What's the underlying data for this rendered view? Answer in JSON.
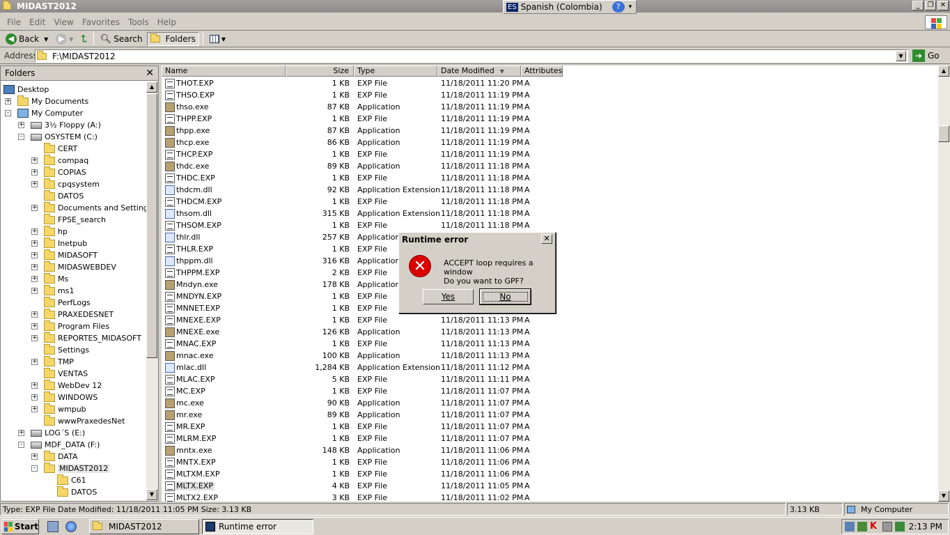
{
  "window": {
    "title": "MIDAST2012"
  },
  "language_bar": {
    "code": "ES",
    "name": "Spanish (Colombia)",
    "help": "?"
  },
  "menu": [
    "File",
    "Edit",
    "View",
    "Favorites",
    "Tools",
    "Help"
  ],
  "toolbar": {
    "back": "Back",
    "search": "Search",
    "folders": "Folders"
  },
  "address": {
    "label": "Address",
    "value": "F:\\MIDAST2012",
    "go": "Go"
  },
  "folders_pane": {
    "title": "Folders",
    "items": [
      {
        "label": "Desktop",
        "indent": 0,
        "icon": "desktop",
        "exp": ""
      },
      {
        "label": "My Documents",
        "indent": 1,
        "icon": "folder",
        "exp": "+"
      },
      {
        "label": "My Computer",
        "indent": 1,
        "icon": "computer",
        "exp": "-"
      },
      {
        "label": "3½ Floppy (A:)",
        "indent": 2,
        "icon": "drive",
        "exp": "+"
      },
      {
        "label": "OSYSTEM (C:)",
        "indent": 2,
        "icon": "drive",
        "exp": "-"
      },
      {
        "label": "CERT",
        "indent": 3,
        "icon": "folder",
        "exp": ""
      },
      {
        "label": "compaq",
        "indent": 3,
        "icon": "folder",
        "exp": "+"
      },
      {
        "label": "COPIAS",
        "indent": 3,
        "icon": "folder",
        "exp": "+"
      },
      {
        "label": "cpqsystem",
        "indent": 3,
        "icon": "folder",
        "exp": "+"
      },
      {
        "label": "DATOS",
        "indent": 3,
        "icon": "folder",
        "exp": ""
      },
      {
        "label": "Documents and Settings",
        "indent": 3,
        "icon": "folder",
        "exp": "+"
      },
      {
        "label": "FPSE_search",
        "indent": 3,
        "icon": "folder",
        "exp": ""
      },
      {
        "label": "hp",
        "indent": 3,
        "icon": "folder",
        "exp": "+"
      },
      {
        "label": "Inetpub",
        "indent": 3,
        "icon": "folder",
        "exp": "+"
      },
      {
        "label": "MIDASOFT",
        "indent": 3,
        "icon": "folder",
        "exp": "+"
      },
      {
        "label": "MIDASWEBDEV",
        "indent": 3,
        "icon": "folder",
        "exp": "+"
      },
      {
        "label": "Ms",
        "indent": 3,
        "icon": "folder",
        "exp": "+"
      },
      {
        "label": "ms1",
        "indent": 3,
        "icon": "folder",
        "exp": "+"
      },
      {
        "label": "PerfLogs",
        "indent": 3,
        "icon": "folder",
        "exp": ""
      },
      {
        "label": "PRAXEDESNET",
        "indent": 3,
        "icon": "folder",
        "exp": "+"
      },
      {
        "label": "Program Files",
        "indent": 3,
        "icon": "folder",
        "exp": "+"
      },
      {
        "label": "REPORTES_MIDASOFT",
        "indent": 3,
        "icon": "folder",
        "exp": "+"
      },
      {
        "label": "Settings",
        "indent": 3,
        "icon": "folder",
        "exp": ""
      },
      {
        "label": "TMP",
        "indent": 3,
        "icon": "folder",
        "exp": "+"
      },
      {
        "label": "VENTAS",
        "indent": 3,
        "icon": "folder",
        "exp": ""
      },
      {
        "label": "WebDev 12",
        "indent": 3,
        "icon": "folder",
        "exp": "+"
      },
      {
        "label": "WINDOWS",
        "indent": 3,
        "icon": "folder",
        "exp": "+"
      },
      {
        "label": "wmpub",
        "indent": 3,
        "icon": "folder",
        "exp": "+"
      },
      {
        "label": "wwwPraxedesNet",
        "indent": 3,
        "icon": "folder",
        "exp": ""
      },
      {
        "label": "LOG´S (E:)",
        "indent": 2,
        "icon": "drive",
        "exp": "+"
      },
      {
        "label": "MDF_DATA (F:)",
        "indent": 2,
        "icon": "drive",
        "exp": "-"
      },
      {
        "label": "DATA",
        "indent": 3,
        "icon": "folder",
        "exp": "+"
      },
      {
        "label": "MIDAST2012",
        "indent": 3,
        "icon": "folder",
        "exp": "-",
        "selected": true
      },
      {
        "label": "C61",
        "indent": 4,
        "icon": "folder",
        "exp": ""
      },
      {
        "label": "DATOS",
        "indent": 4,
        "icon": "folder",
        "exp": ""
      }
    ]
  },
  "columns": {
    "name": "Name",
    "size": "Size",
    "type": "Type",
    "date": "Date Modified",
    "attr": "Attributes"
  },
  "files": [
    {
      "name": "THOT.EXP",
      "size": "1 KB",
      "type": "EXP File",
      "date": "11/18/2011 11:20 PM",
      "attr": "A",
      "icon": "exp"
    },
    {
      "name": "THSO.EXP",
      "size": "1 KB",
      "type": "EXP File",
      "date": "11/18/2011 11:19 PM",
      "attr": "A",
      "icon": "exp"
    },
    {
      "name": "thso.exe",
      "size": "87 KB",
      "type": "Application",
      "date": "11/18/2011 11:19 PM",
      "attr": "A",
      "icon": "app"
    },
    {
      "name": "THPP.EXP",
      "size": "1 KB",
      "type": "EXP File",
      "date": "11/18/2011 11:19 PM",
      "attr": "A",
      "icon": "exp"
    },
    {
      "name": "thpp.exe",
      "size": "87 KB",
      "type": "Application",
      "date": "11/18/2011 11:19 PM",
      "attr": "A",
      "icon": "app"
    },
    {
      "name": "thcp.exe",
      "size": "86 KB",
      "type": "Application",
      "date": "11/18/2011 11:19 PM",
      "attr": "A",
      "icon": "app"
    },
    {
      "name": "THCP.EXP",
      "size": "1 KB",
      "type": "EXP File",
      "date": "11/18/2011 11:19 PM",
      "attr": "A",
      "icon": "exp"
    },
    {
      "name": "thdc.exe",
      "size": "89 KB",
      "type": "Application",
      "date": "11/18/2011 11:18 PM",
      "attr": "A",
      "icon": "app"
    },
    {
      "name": "THDC.EXP",
      "size": "1 KB",
      "type": "EXP File",
      "date": "11/18/2011 11:18 PM",
      "attr": "A",
      "icon": "exp"
    },
    {
      "name": "thdcm.dll",
      "size": "92 KB",
      "type": "Application Extension",
      "date": "11/18/2011 11:18 PM",
      "attr": "A",
      "icon": "dll"
    },
    {
      "name": "THDCM.EXP",
      "size": "1 KB",
      "type": "EXP File",
      "date": "11/18/2011 11:18 PM",
      "attr": "A",
      "icon": "exp"
    },
    {
      "name": "thsom.dll",
      "size": "315 KB",
      "type": "Application Extension",
      "date": "11/18/2011 11:18 PM",
      "attr": "A",
      "icon": "dll"
    },
    {
      "name": "THSOM.EXP",
      "size": "1 KB",
      "type": "EXP File",
      "date": "11/18/2011 11:18 PM",
      "attr": "A",
      "icon": "exp"
    },
    {
      "name": "thlr.dll",
      "size": "257 KB",
      "type": "Application Extension",
      "date": "",
      "attr": "",
      "icon": "dll"
    },
    {
      "name": "THLR.EXP",
      "size": "1 KB",
      "type": "EXP File",
      "date": "",
      "attr": "",
      "icon": "exp"
    },
    {
      "name": "thppm.dll",
      "size": "316 KB",
      "type": "Application Extension",
      "date": "",
      "attr": "",
      "icon": "dll"
    },
    {
      "name": "THPPM.EXP",
      "size": "2 KB",
      "type": "EXP File",
      "date": "",
      "attr": "",
      "icon": "exp"
    },
    {
      "name": "Mndyn.exe",
      "size": "178 KB",
      "type": "Application",
      "date": "",
      "attr": "",
      "icon": "app"
    },
    {
      "name": "MNDYN.EXP",
      "size": "1 KB",
      "type": "EXP File",
      "date": "",
      "attr": "",
      "icon": "exp"
    },
    {
      "name": "MNNET.EXP",
      "size": "1 KB",
      "type": "EXP File",
      "date": "",
      "attr": "",
      "icon": "exp"
    },
    {
      "name": "MNEXE.EXP",
      "size": "1 KB",
      "type": "EXP File",
      "date": "11/18/2011 11:13 PM",
      "attr": "A",
      "icon": "exp"
    },
    {
      "name": "MNEXE.exe",
      "size": "126 KB",
      "type": "Application",
      "date": "11/18/2011 11:13 PM",
      "attr": "A",
      "icon": "app"
    },
    {
      "name": "MNAC.EXP",
      "size": "1 KB",
      "type": "EXP File",
      "date": "11/18/2011 11:13 PM",
      "attr": "A",
      "icon": "exp"
    },
    {
      "name": "mnac.exe",
      "size": "100 KB",
      "type": "Application",
      "date": "11/18/2011 11:13 PM",
      "attr": "A",
      "icon": "app"
    },
    {
      "name": "mlac.dll",
      "size": "1,284 KB",
      "type": "Application Extension",
      "date": "11/18/2011 11:12 PM",
      "attr": "A",
      "icon": "dll"
    },
    {
      "name": "MLAC.EXP",
      "size": "5 KB",
      "type": "EXP File",
      "date": "11/18/2011 11:11 PM",
      "attr": "A",
      "icon": "exp"
    },
    {
      "name": "MC.EXP",
      "size": "1 KB",
      "type": "EXP File",
      "date": "11/18/2011 11:07 PM",
      "attr": "A",
      "icon": "exp"
    },
    {
      "name": "mc.exe",
      "size": "90 KB",
      "type": "Application",
      "date": "11/18/2011 11:07 PM",
      "attr": "A",
      "icon": "app"
    },
    {
      "name": "mr.exe",
      "size": "89 KB",
      "type": "Application",
      "date": "11/18/2011 11:07 PM",
      "attr": "A",
      "icon": "app"
    },
    {
      "name": "MR.EXP",
      "size": "1 KB",
      "type": "EXP File",
      "date": "11/18/2011 11:07 PM",
      "attr": "A",
      "icon": "exp"
    },
    {
      "name": "MLRM.EXP",
      "size": "1 KB",
      "type": "EXP File",
      "date": "11/18/2011 11:07 PM",
      "attr": "A",
      "icon": "exp"
    },
    {
      "name": "mntx.exe",
      "size": "148 KB",
      "type": "Application",
      "date": "11/18/2011 11:06 PM",
      "attr": "A",
      "icon": "app"
    },
    {
      "name": "MNTX.EXP",
      "size": "1 KB",
      "type": "EXP File",
      "date": "11/18/2011 11:06 PM",
      "attr": "A",
      "icon": "exp"
    },
    {
      "name": "MLTXM.EXP",
      "size": "1 KB",
      "type": "EXP File",
      "date": "11/18/2011 11:06 PM",
      "attr": "A",
      "icon": "exp"
    },
    {
      "name": "MLTX.EXP",
      "size": "4 KB",
      "type": "EXP File",
      "date": "11/18/2011 11:05 PM",
      "attr": "A",
      "icon": "exp",
      "selected": true
    },
    {
      "name": "MLTX2.EXP",
      "size": "3 KB",
      "type": "EXP File",
      "date": "11/18/2011 11:02 PM",
      "attr": "A",
      "icon": "exp"
    }
  ],
  "dialog": {
    "title": "Runtime error",
    "line1": "ACCEPT loop requires a window",
    "line2": "Do you want to GPF?",
    "yes": "Yes",
    "no": "No"
  },
  "statusbar": {
    "info": "Type: EXP File Date Modified: 11/18/2011 11:05 PM Size: 3.13 KB",
    "size": "3.13 KB",
    "zone": "My Computer"
  },
  "taskbar": {
    "start": "Start",
    "tasks": [
      "MIDAST2012",
      "Runtime error"
    ],
    "clock": "2:13 PM"
  },
  "colors": {
    "selection": "#e2e2e2",
    "error": "#d90000",
    "folder": "#f4d768"
  }
}
